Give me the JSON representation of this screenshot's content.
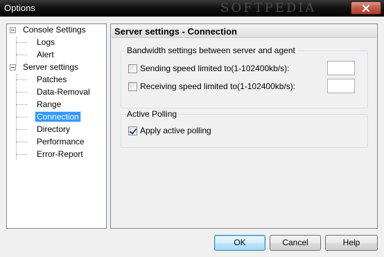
{
  "window": {
    "title": "Options",
    "titlebar_watermark": "SOFTPEDIA"
  },
  "tree": {
    "selected": "Connection",
    "groups": [
      {
        "label": "Console Settings",
        "children": [
          "Logs",
          "Alert"
        ]
      },
      {
        "label": "Server settings",
        "children": [
          "Patches",
          "Data-Removal",
          "Range",
          "Connection",
          "Directory",
          "Performance",
          "Error-Report"
        ]
      }
    ]
  },
  "panel": {
    "header": "Server settings - Connection",
    "bandwidth": {
      "title": "Bandwidth settings between server and agent",
      "sending": {
        "label": "Sending speed limited to(1-102400kb/s):",
        "checked": false,
        "value": ""
      },
      "receiving": {
        "label": "Receiving speed limited to(1-102400kb/s):",
        "checked": false,
        "value": ""
      }
    },
    "polling": {
      "title": "Active Polling",
      "apply": {
        "label": "Apply active polling",
        "checked": true
      }
    }
  },
  "buttons": {
    "ok": "OK",
    "cancel": "Cancel",
    "help": "Help"
  }
}
